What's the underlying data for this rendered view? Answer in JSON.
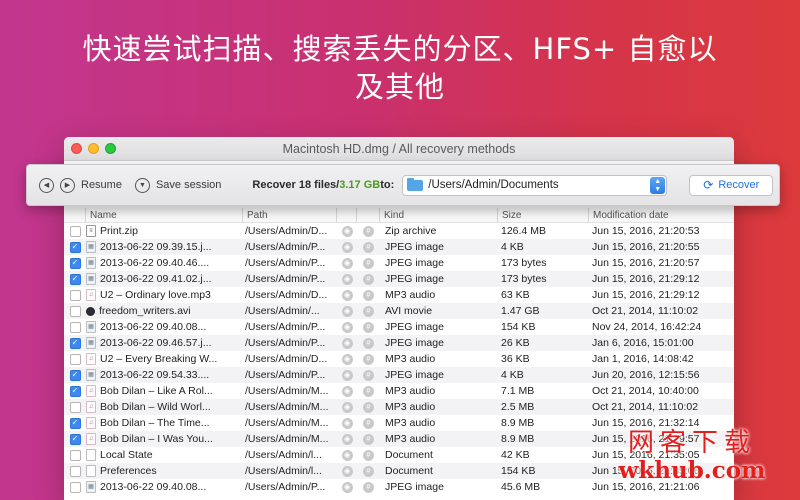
{
  "headline": {
    "line1": "快速尝试扫描、搜索丢失的分区、HFS+ 自愈以",
    "line2": "及其他"
  },
  "window": {
    "title": "Macintosh HD.dmg / All recovery methods"
  },
  "toolbar": {
    "resume_label": "Resume",
    "save_session_label": "Save session",
    "recover_prefix": "Recover 18 files/",
    "recover_size": "3.17 GB",
    "recover_suffix": " to:",
    "destination_path": "/Users/Admin/Documents",
    "recover_button_label": "Recover"
  },
  "table": {
    "headers": {
      "name": "Name",
      "path": "Path",
      "kind": "Kind",
      "size": "Size",
      "date": "Modification date"
    },
    "rows": [
      {
        "checked": false,
        "icon": "zip",
        "name": "Print.zip",
        "path": "/Users/Admin/D...",
        "kind": "Zip archive",
        "size": "126.4 MB",
        "date": "Jun 15, 2016, 21:20:53"
      },
      {
        "checked": true,
        "icon": "jpeg",
        "name": "2013-06-22 09.39.15.j...",
        "path": "/Users/Admin/P...",
        "kind": "JPEG image",
        "size": "4 KB",
        "date": "Jun 15, 2016, 21:20:55"
      },
      {
        "checked": true,
        "icon": "jpeg",
        "name": "2013-06-22 09.40.46....",
        "path": "/Users/Admin/P...",
        "kind": "JPEG image",
        "size": "173 bytes",
        "date": "Jun 15, 2016, 21:20:57"
      },
      {
        "checked": true,
        "icon": "jpeg",
        "name": "2013-06-22 09.41.02.j...",
        "path": "/Users/Admin/P...",
        "kind": "JPEG image",
        "size": "173 bytes",
        "date": "Jun 15, 2016, 21:29:12"
      },
      {
        "checked": false,
        "icon": "mp3",
        "name": "U2 – Ordinary love.mp3",
        "path": "/Users/Admin/D...",
        "kind": "MP3 audio",
        "size": "63 KB",
        "date": "Jun 15, 2016, 21:29:12"
      },
      {
        "checked": false,
        "icon": "avi",
        "name": "freedom_writers.avi",
        "path": "/Users/Admin/...",
        "kind": "AVI movie",
        "size": "1.47 GB",
        "date": "Oct 21, 2014, 11:10:02"
      },
      {
        "checked": false,
        "icon": "jpeg",
        "name": "2013-06-22 09.40.08...",
        "path": "/Users/Admin/P...",
        "kind": "JPEG image",
        "size": "154 KB",
        "date": "Nov 24, 2014, 16:42:24"
      },
      {
        "checked": true,
        "icon": "jpeg",
        "name": "2013-06-22 09.46.57.j...",
        "path": "/Users/Admin/P...",
        "kind": "JPEG image",
        "size": "26 KB",
        "date": "Jan 6, 2016, 15:01:00"
      },
      {
        "checked": false,
        "icon": "mp3",
        "name": "U2 – Every Breaking W...",
        "path": "/Users/Admin/D...",
        "kind": "MP3 audio",
        "size": "36 KB",
        "date": "Jan 1, 2016, 14:08:42"
      },
      {
        "checked": true,
        "icon": "jpeg",
        "name": "2013-06-22 09.54.33....",
        "path": "/Users/Admin/P...",
        "kind": "JPEG image",
        "size": "4 KB",
        "date": "Jun 20, 2016, 12:15:56"
      },
      {
        "checked": true,
        "icon": "mp3",
        "name": "Bob Dilan – Like A Rol...",
        "path": "/Users/Admin/M...",
        "kind": "MP3 audio",
        "size": "7.1 MB",
        "date": "Oct 21, 2014, 10:40:00"
      },
      {
        "checked": false,
        "icon": "mp3",
        "name": "Bob Dilan – Wild Worl...",
        "path": "/Users/Admin/M...",
        "kind": "MP3 audio",
        "size": "2.5 MB",
        "date": "Oct 21, 2014, 11:10:02"
      },
      {
        "checked": true,
        "icon": "mp3",
        "name": "Bob Dilan – The Time...",
        "path": "/Users/Admin/M...",
        "kind": "MP3 audio",
        "size": "8.9 MB",
        "date": "Jun 15, 2016, 21:32:14"
      },
      {
        "checked": true,
        "icon": "mp3",
        "name": "Bob Dilan – I Was You...",
        "path": "/Users/Admin/M...",
        "kind": "MP3 audio",
        "size": "8.9 MB",
        "date": "Jun 15, 2016, 21:29:57"
      },
      {
        "checked": false,
        "icon": "doc",
        "name": "Local State",
        "path": "/Users/Admin/l...",
        "kind": "Document",
        "size": "42 KB",
        "date": "Jun 15, 2016, 21:35:05"
      },
      {
        "checked": false,
        "icon": "doc",
        "name": "Preferences",
        "path": "/Users/Admin/l...",
        "kind": "Document",
        "size": "154 KB",
        "date": "Jun 15, 2016, 21:35:06"
      },
      {
        "checked": false,
        "icon": "jpeg",
        "name": "2013-06-22 09.40.08...",
        "path": "/Users/Admin/P...",
        "kind": "JPEG image",
        "size": "45.6 MB",
        "date": "Jun 15, 2016, 21:21:06"
      }
    ]
  },
  "watermark": {
    "cn": "网客下载",
    "en": "wkhub.com"
  }
}
